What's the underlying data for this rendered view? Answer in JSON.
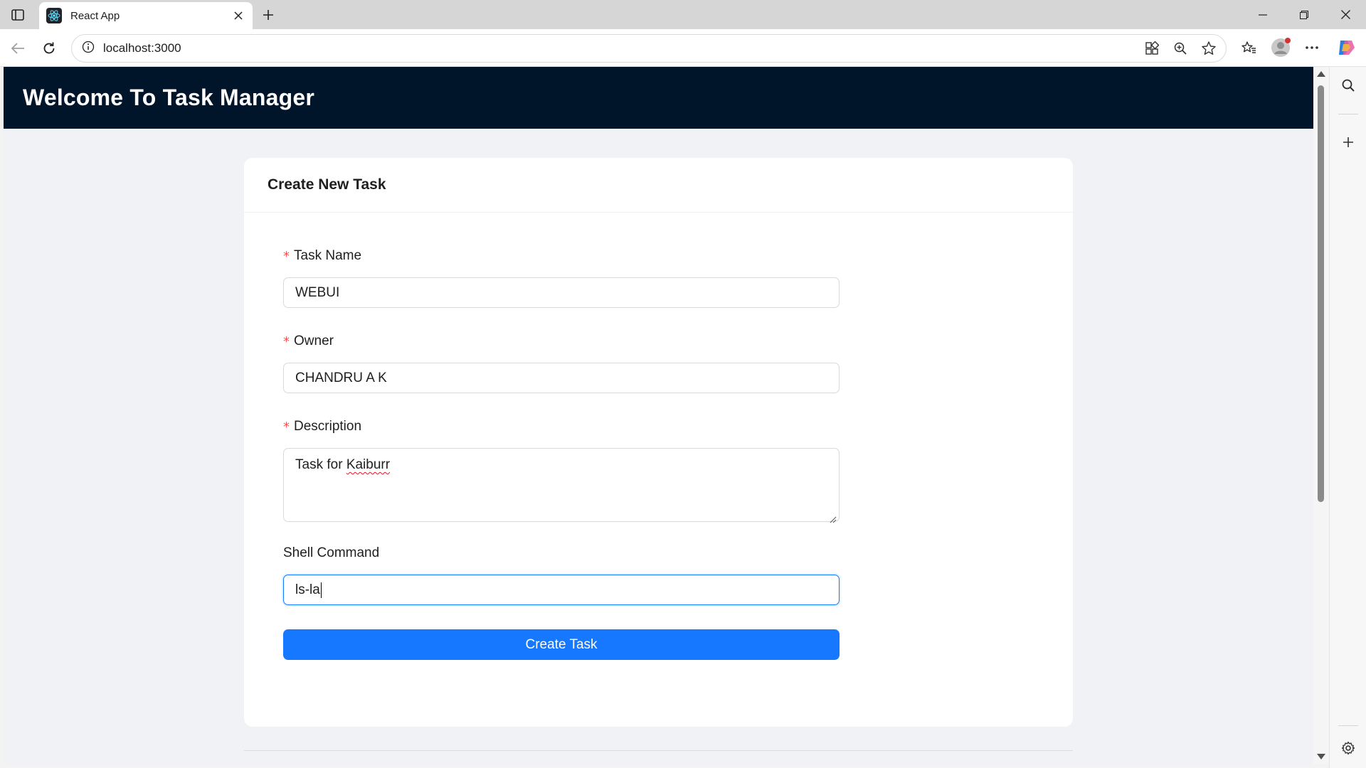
{
  "browser": {
    "tab_title": "React App",
    "url": "localhost:3000"
  },
  "icons": {
    "tab_actions": "tab-actions-icon",
    "favicon": "react-logo-icon",
    "tab_close": "close-icon",
    "new_tab": "plus-icon",
    "back": "back-arrow-icon",
    "refresh": "refresh-icon",
    "site_info": "info-icon",
    "app_available": "app-grid-icon",
    "zoom": "zoom-icon",
    "favorite": "star-icon",
    "favorites": "favorites-icon",
    "profile": "profile-icon",
    "more": "ellipsis-icon",
    "copilot": "copilot-icon",
    "sidebar_search": "search-icon",
    "sidebar_add": "plus-icon",
    "sidebar_settings": "gear-icon"
  },
  "app": {
    "header_title": "Welcome To Task Manager"
  },
  "form": {
    "card_title": "Create New Task",
    "task_name": {
      "label": "Task Name",
      "required": true,
      "value": "WEBUI"
    },
    "owner": {
      "label": "Owner",
      "required": true,
      "value": "CHANDRU A K"
    },
    "description": {
      "label": "Description",
      "required": true,
      "value_prefix": "Task for ",
      "value_misspelled": "Kaiburr"
    },
    "shell_command": {
      "label": "Shell Command",
      "required": false,
      "value": "ls-la"
    },
    "submit_label": "Create Task",
    "required_mark": "*"
  },
  "colors": {
    "header_bg": "#001529",
    "page_bg": "#f0f2f5",
    "primary": "#1677ff",
    "required": "#ff4d4f"
  }
}
